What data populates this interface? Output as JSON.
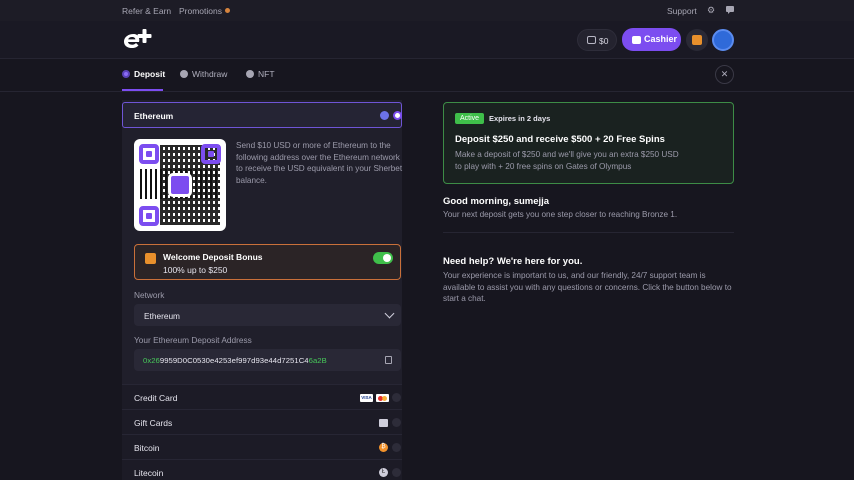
{
  "topbar": {
    "refer_label": "Refer & Earn",
    "promotions_label": "Promotions",
    "support_label": "Support",
    "icons": [
      "gear-icon",
      "chat-icon"
    ]
  },
  "header": {
    "logo_text": "e+",
    "balance": "$0",
    "cashier_label": "Cashier"
  },
  "tabs": [
    {
      "label": "Deposit",
      "active": true
    },
    {
      "label": "Withdraw",
      "active": false
    },
    {
      "label": "NFT",
      "active": false
    }
  ],
  "deposit": {
    "currency": "Ethereum",
    "instructions": "Send $10 USD or more of Ethereum to the following address over the Ethereum network to receive the USD equivalent in your Sherbet balance.",
    "bonus": {
      "title": "Welcome Deposit Bonus",
      "subtitle": "100% up to $250",
      "enabled": true
    },
    "network_label": "Network",
    "network_value": "Ethereum",
    "address_label": "Your Ethereum Deposit Address",
    "address_prefix": "0x26",
    "address_middle": "9959D0C0530e4253ef997d93e44d7251C4",
    "address_suffix": "6a2B"
  },
  "payment_methods": [
    {
      "label": "Credit Card"
    },
    {
      "label": "Gift Cards"
    },
    {
      "label": "Bitcoin"
    },
    {
      "label": "Litecoin"
    }
  ],
  "card_brands": {
    "visa": "VISA"
  },
  "promo": {
    "badge": "Active",
    "expires": "Expires in 2 days",
    "title": "Deposit $250 and receive $500 + 20 Free Spins",
    "description": "Make a deposit of $250 and we'll give you an extra $250 USD to play with + 20 free spins on Gates of Olympus"
  },
  "greeting": {
    "title": "Good morning, sumejja",
    "subtitle": "Your next deposit gets you one step closer to reaching Bronze 1."
  },
  "help": {
    "title": "Need help? We're here for you.",
    "description": "Your experience is important to us, and our friendly, 24/7 support team is available to assist you with any questions or concerns. Click the button below to start a chat."
  },
  "colors": {
    "accent": "#7c4df0",
    "success": "#3fbf4a",
    "bonus_border": "#c9703a",
    "background": "#17161f"
  }
}
